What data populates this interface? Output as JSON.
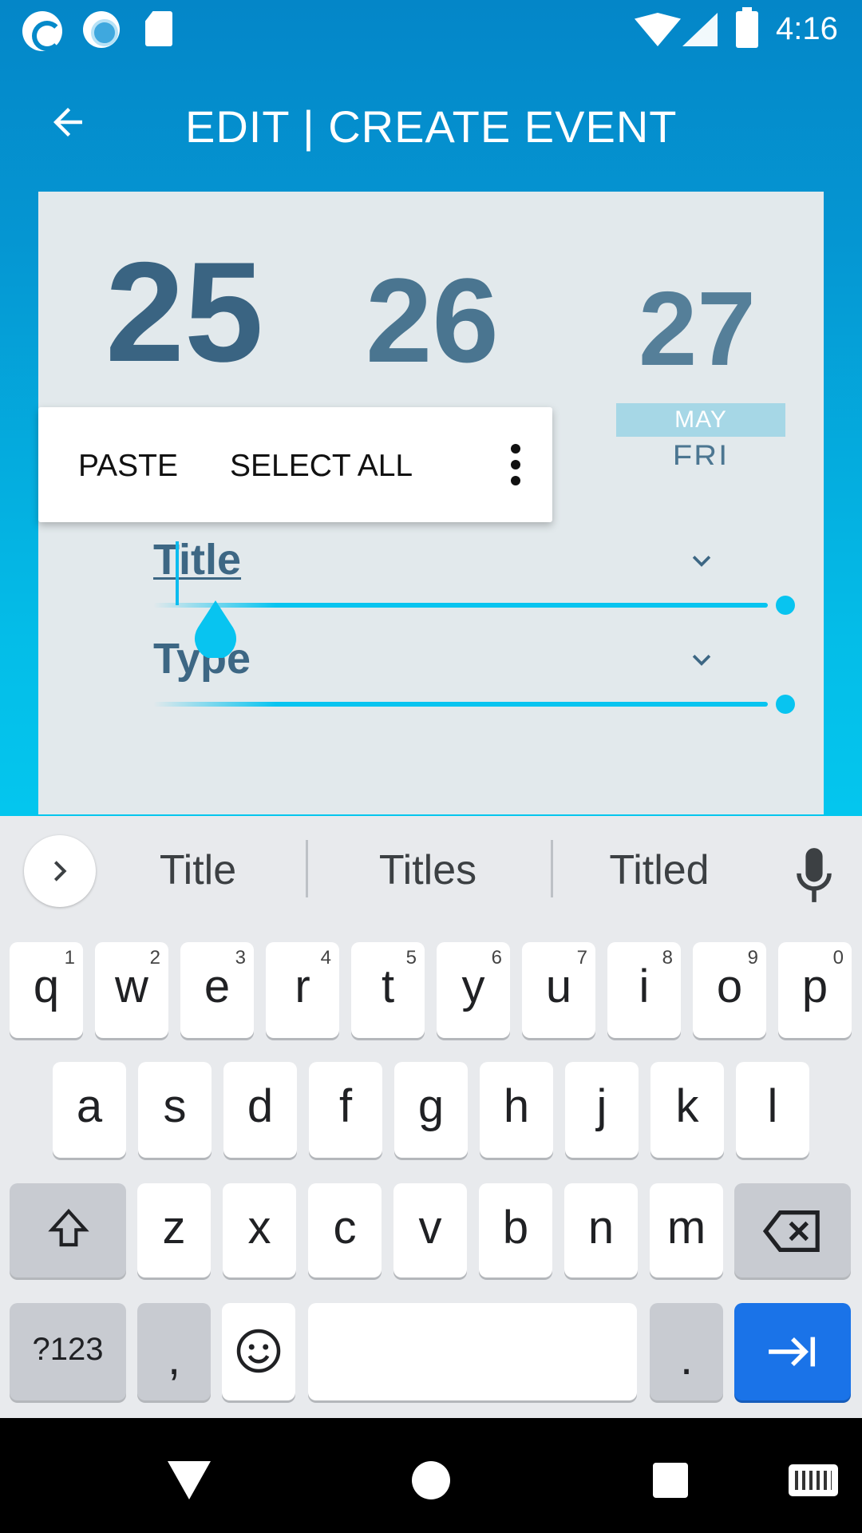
{
  "status_bar": {
    "time": "4:16",
    "icons": [
      "app-notification-icon",
      "circle-app-icon",
      "sd-card-icon",
      "wifi-icon",
      "cell-signal-icon",
      "battery-icon"
    ]
  },
  "app_bar": {
    "back_icon": "arrow-left-icon",
    "title": "EDIT | CREATE EVENT"
  },
  "date_picker": {
    "days": [
      "25",
      "26",
      "27"
    ],
    "month": "MAY",
    "weekday": "FRI"
  },
  "form": {
    "title_field": {
      "value": "Title"
    },
    "type_field": {
      "value": "Type"
    }
  },
  "context_menu": {
    "paste_label": "PASTE",
    "select_all_label": "SELECT ALL",
    "more_icon": "more-vert-icon"
  },
  "keyboard": {
    "suggestions": [
      "Title",
      "Titles",
      "Titled"
    ],
    "row1": [
      {
        "ch": "q",
        "hint": "1"
      },
      {
        "ch": "w",
        "hint": "2"
      },
      {
        "ch": "e",
        "hint": "3"
      },
      {
        "ch": "r",
        "hint": "4"
      },
      {
        "ch": "t",
        "hint": "5"
      },
      {
        "ch": "y",
        "hint": "6"
      },
      {
        "ch": "u",
        "hint": "7"
      },
      {
        "ch": "i",
        "hint": "8"
      },
      {
        "ch": "o",
        "hint": "9"
      },
      {
        "ch": "p",
        "hint": "0"
      }
    ],
    "row2": [
      "a",
      "s",
      "d",
      "f",
      "g",
      "h",
      "j",
      "k",
      "l"
    ],
    "row3": [
      "z",
      "x",
      "c",
      "v",
      "b",
      "n",
      "m"
    ],
    "symbols_label": "?123",
    "comma_label": ",",
    "period_label": ".",
    "enter_color": "#1a73e8"
  },
  "colors": {
    "accent": "#08c4f0",
    "date_text": "#3d6784",
    "card_bg": "#e2e9ec"
  }
}
